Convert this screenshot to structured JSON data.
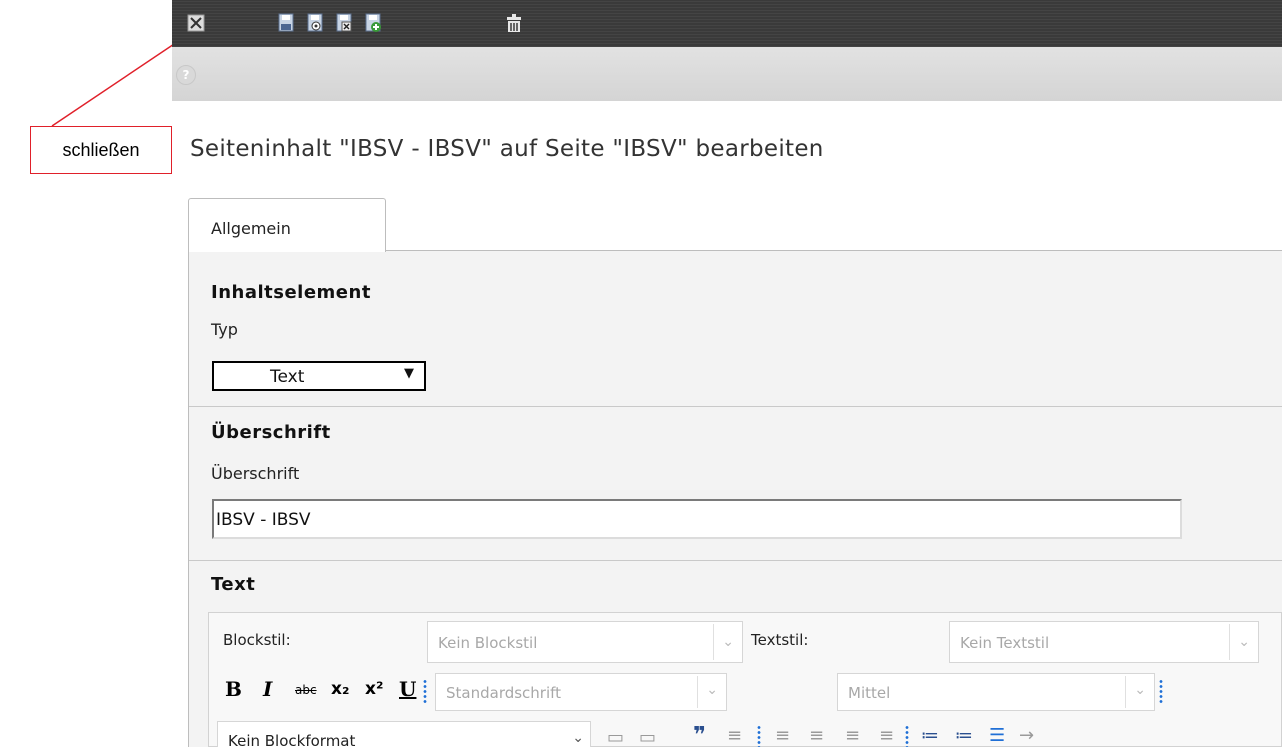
{
  "annotation": {
    "label": "schließen"
  },
  "toolbar": {
    "icons": [
      "close-icon",
      "save-icon",
      "save-view-icon",
      "save-close-icon",
      "save-new-icon",
      "delete-icon"
    ]
  },
  "help": {
    "glyph": "?"
  },
  "page": {
    "title": "Seiteninhalt \"IBSV - IBSV\" auf Seite \"IBSV\" bearbeiten"
  },
  "tabs": [
    {
      "label": "Allgemein",
      "active": true
    }
  ],
  "sections": {
    "content_element": {
      "title": "Inhaltselement",
      "type_label": "Typ",
      "type_value": "Text"
    },
    "header": {
      "title": "Überschrift",
      "field_label": "Überschrift",
      "field_value": "IBSV - IBSV"
    },
    "text": {
      "title": "Text"
    }
  },
  "rte": {
    "blockstyle_label": "Blockstil:",
    "blockstyle_value": "Kein Blockstil",
    "textstyle_label": "Textstil:",
    "textstyle_value": "Kein Textstil",
    "format_buttons": {
      "bold": "B",
      "italic": "I",
      "strike": "abc",
      "subscript": "x₂",
      "superscript": "x²",
      "underline": "U"
    },
    "font_value": "Standardschrift",
    "size_value": "Mittel",
    "blockformat_value": "Kein Blockformat"
  },
  "colors": {
    "annotation_red": "#e0202a",
    "toolbar_bg": "#3a3a3a",
    "accent_blue": "#1f6fd6"
  }
}
